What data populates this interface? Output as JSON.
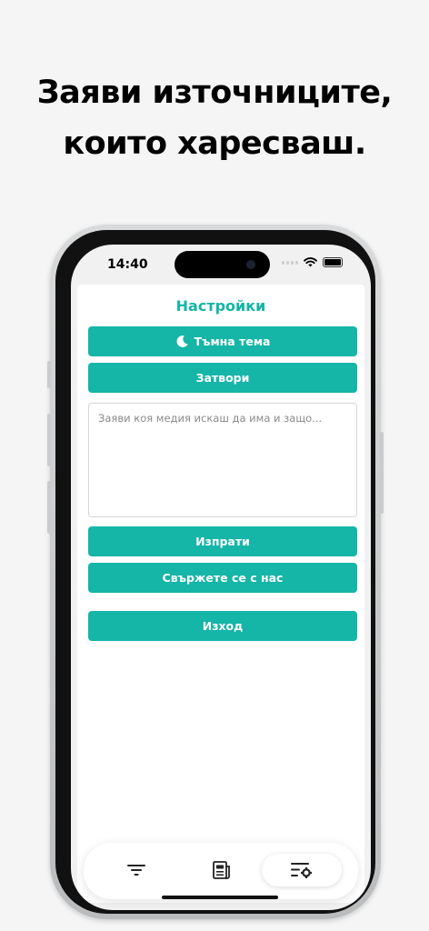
{
  "promo": {
    "line1": "Заяви източниците,",
    "line2": "които харесваш."
  },
  "status_bar": {
    "time": "14:40"
  },
  "settings": {
    "title": "Настройки",
    "dark_theme_label": "Тъмна тема",
    "close_label": "Затвори",
    "request_placeholder": "Заяви коя медия искаш да има и защо...",
    "request_value": "",
    "send_label": "Изпрати",
    "contact_label": "Свържете се с нас",
    "logout_label": "Изход"
  },
  "nav": {
    "tabs": [
      {
        "icon": "filter-icon",
        "active": false
      },
      {
        "icon": "newspaper-icon",
        "active": false
      },
      {
        "icon": "settings-list-icon",
        "active": true
      }
    ]
  },
  "colors": {
    "accent": "#15b5a7",
    "background": "#f5f5f5"
  }
}
